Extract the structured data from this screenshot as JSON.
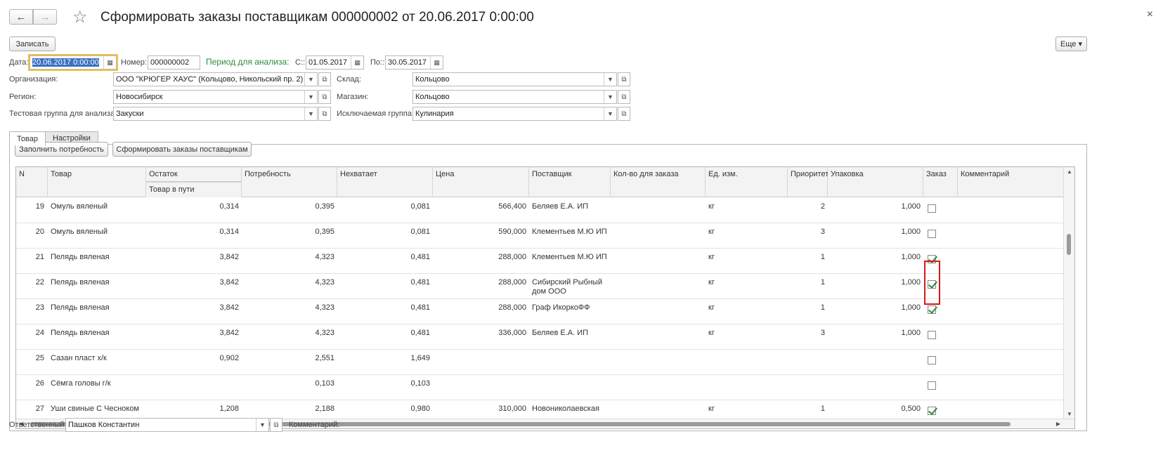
{
  "window": {
    "title": "Сформировать заказы поставщикам 000000002 от 20.06.2017 0:00:00",
    "back_icon": "←",
    "forward_icon": "→",
    "star_icon": "☆",
    "close_icon": "×"
  },
  "toolbar": {
    "save_label": "Записать",
    "more_label": "Еще ▾"
  },
  "header": {
    "date_label": "Дата:",
    "date_value": "20.06.2017  0:00:00",
    "number_label": "Номер:",
    "number_value": "000000002",
    "period_label": "Период для анализа:",
    "from_label": "С::",
    "from_value": "01.05.2017",
    "to_label": "По::",
    "to_value": "30.05.2017",
    "org_label": "Организация:",
    "org_value": "ООО \"КРЮГЕР ХАУС\" (Кольцово, Никольский пр. 2)",
    "warehouse_label": "Склад:",
    "warehouse_value": "Кольцово",
    "region_label": "Регион:",
    "region_value": "Новосибирск",
    "store_label": "Магазин:",
    "store_value": "Кольцово",
    "test_group_label": "Тестовая группа для анализа:",
    "test_group_value": "Закуски",
    "excluded_group_label": "Исключаемая группа:",
    "excluded_group_value": "Кулинария"
  },
  "tabs": [
    {
      "label": "Товар"
    },
    {
      "label": "Настройки"
    }
  ],
  "actions": {
    "fill_label": "Заполнить потребность",
    "create_orders_label": "Сформировать заказы поставщикам"
  },
  "table": {
    "columns": {
      "n": "N",
      "product": "Товар",
      "stock": "Остаток",
      "in_transit": "Товар в пути",
      "need": "Потребность",
      "shortage": "Нехватает",
      "price": "Цена",
      "supplier": "Поставщик",
      "qty": "Кол-во для заказа",
      "unit": "Ед. изм.",
      "priority": "Приоритет",
      "pack": "Упаковка",
      "order": "Заказ",
      "comment": "Комментарий"
    },
    "rows": [
      {
        "n": "19",
        "product": "Омуль вяленый",
        "stock": "0,314",
        "need": "0,395",
        "shortage": "0,081",
        "price": "566,400",
        "supplier": "Беляев Е.А. ИП",
        "unit": "кг",
        "priority": "2",
        "pack": "1,000",
        "order": false
      },
      {
        "n": "20",
        "product": "Омуль вяленый",
        "stock": "0,314",
        "need": "0,395",
        "shortage": "0,081",
        "price": "590,000",
        "supplier": "Клементьев М.Ю ИП",
        "unit": "кг",
        "priority": "3",
        "pack": "1,000",
        "order": false
      },
      {
        "n": "21",
        "product": "Пелядь вяленая",
        "stock": "3,842",
        "need": "4,323",
        "shortage": "0,481",
        "price": "288,000",
        "supplier": "Клементьев М.Ю ИП",
        "unit": "кг",
        "priority": "1",
        "pack": "1,000",
        "order": true
      },
      {
        "n": "22",
        "product": "Пелядь вяленая",
        "stock": "3,842",
        "need": "4,323",
        "shortage": "0,481",
        "price": "288,000",
        "supplier": "Сибирский Рыбный дом ООО",
        "unit": "кг",
        "priority": "1",
        "pack": "1,000",
        "order": true
      },
      {
        "n": "23",
        "product": "Пелядь вяленая",
        "stock": "3,842",
        "need": "4,323",
        "shortage": "0,481",
        "price": "288,000",
        "supplier": "Граф ИкоркоФФ",
        "unit": "кг",
        "priority": "1",
        "pack": "1,000",
        "order": true
      },
      {
        "n": "24",
        "product": "Пелядь вяленая",
        "stock": "3,842",
        "need": "4,323",
        "shortage": "0,481",
        "price": "336,000",
        "supplier": "Беляев Е.А. ИП",
        "unit": "кг",
        "priority": "3",
        "pack": "1,000",
        "order": false
      },
      {
        "n": "25",
        "product": "Сазан пласт х/к",
        "stock": "0,902",
        "need": "2,551",
        "shortage": "1,649",
        "price": "",
        "supplier": "",
        "unit": "",
        "priority": "",
        "pack": "",
        "order": false
      },
      {
        "n": "26",
        "product": "Сёмга головы г/к",
        "stock": "",
        "need": "0,103",
        "shortage": "0,103",
        "price": "",
        "supplier": "",
        "unit": "",
        "priority": "",
        "pack": "",
        "order": false
      },
      {
        "n": "27",
        "product": "Уши свиные С Чесноком",
        "stock": "1,208",
        "need": "2,188",
        "shortage": "0,980",
        "price": "310,000",
        "supplier": "Новониколаевская",
        "unit": "кг",
        "priority": "1",
        "pack": "0,500",
        "order": true
      }
    ]
  },
  "footer": {
    "responsible_label": "Ответственный:",
    "responsible_value": "Пашков Константин",
    "comment_label": "Комментарий:"
  }
}
